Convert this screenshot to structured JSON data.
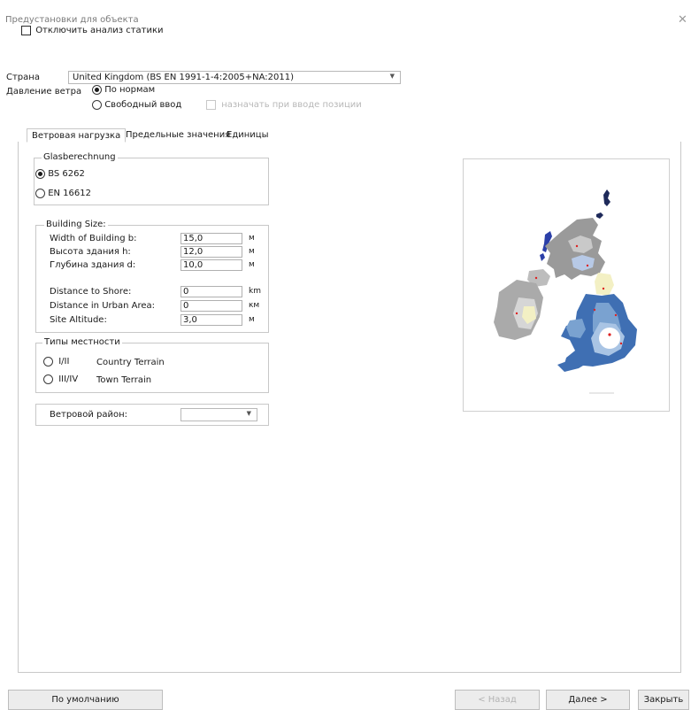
{
  "dialog": {
    "title": "Предустановки для объекта"
  },
  "top": {
    "disable_static_label": "Отключить анализ статики",
    "country_label": "Страна",
    "country_value": "United Kingdom (BS EN 1991-1-4:2005+NA:2011)",
    "wind_pressure_label": "Давление ветра",
    "wind_by_norms_label": "По нормам",
    "wind_free_input_label": "Свободный ввод",
    "assign_on_position_label": "назначать при вводе позиции"
  },
  "tabs": [
    {
      "label": "Ветровая нагрузка",
      "active": true
    },
    {
      "label": "Предельные значения",
      "active": false
    },
    {
      "label": "Единицы",
      "active": false
    }
  ],
  "glass": {
    "title": "Glasberechnung",
    "options": [
      {
        "label": "BS 6262",
        "selected": true
      },
      {
        "label": "EN 16612",
        "selected": false
      }
    ]
  },
  "building": {
    "title": "Building Size:",
    "width_label": "Width of Building b:",
    "width_value": "15,0",
    "width_unit": "м",
    "height_label": "Высота здания h:",
    "height_value": "12,0",
    "height_unit": "м",
    "depth_label": "Глубина здания d:",
    "depth_value": "10,0",
    "depth_unit": "м",
    "shore_label": "Distance to Shore:",
    "shore_value": "0",
    "shore_unit": "km",
    "urban_label": "Distance in Urban Area:",
    "urban_value": "0",
    "urban_unit": "км",
    "altitude_label": "Site Altitude:",
    "altitude_value": "3,0",
    "altitude_unit": "м"
  },
  "terrain": {
    "title": "Типы местности",
    "options": [
      {
        "code": "I/II",
        "label": "Country Terrain",
        "selected": false
      },
      {
        "code": "III/IV",
        "label": "Town Terrain",
        "selected": false
      }
    ]
  },
  "wind_zone": {
    "label": "Ветровой район:",
    "value": ""
  },
  "buttons": {
    "defaults": "По умолчанию",
    "back": "< Назад",
    "next": "Далее >",
    "close": "Закрыть"
  },
  "colors": {
    "map_dark_blue": "#3f6fb3",
    "map_mid_blue": "#7aa2d0",
    "map_light_blue": "#a9c4e4",
    "map_yellow": "#f3f0c4",
    "map_gray": "#b9b9b9",
    "map_dark_gray": "#8a8a8a"
  }
}
